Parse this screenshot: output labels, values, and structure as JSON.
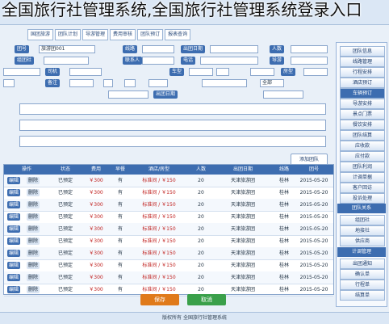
{
  "caption": "全国旅行社管理系统,全国旅行社管理系统登录入口",
  "tabs": [
    "国团旅游",
    "团队计划",
    "导游管理",
    "费用审核",
    "团队预订",
    "报表查询"
  ],
  "form_labels": [
    "团号",
    "线路",
    "出团日期",
    "人数",
    "组团社",
    "联系人",
    "电话",
    "导游",
    "司机",
    "车型",
    "房型",
    "备注"
  ],
  "form_values": [
    "旅游团001",
    "",
    "",
    "",
    "",
    "",
    "",
    "",
    "",
    "",
    "",
    ""
  ],
  "form_select": "全部",
  "add_button": "添加团队",
  "sidebar": {
    "items_top": [
      "团队信息",
      "线路管理",
      "行程安排",
      "酒店预订",
      "车辆预订",
      "导游安排",
      "景点门票",
      "餐饮安排",
      "团队结算",
      "应收款",
      "应付款",
      "团队利润",
      "计调单据",
      "客户回访",
      "投诉处理"
    ],
    "section1": "团队关系",
    "items_mid": [
      "组团社",
      "地接社",
      "供应商",
      "合作伙伴"
    ],
    "section2": "计调管理",
    "items_bottom": [
      "出团通知",
      "确认单",
      "行程单",
      "结算单",
      "费用单",
      "派车单",
      "报账单",
      "其他"
    ]
  },
  "table": {
    "headers": [
      "团号",
      "线路",
      "出团日期",
      "人数",
      "酒店/房型",
      "早餐",
      "费用",
      "状态",
      "操作"
    ],
    "rows": [
      [
        "2015-05-20",
        "桂林",
        "天津旅游团",
        "20",
        "标准间 / ￥150",
        "有",
        "￥300",
        "已预定"
      ],
      [
        "2015-05-20",
        "桂林",
        "天津旅游团",
        "20",
        "标准间 / ￥150",
        "有",
        "￥300",
        "已预定"
      ],
      [
        "2015-05-20",
        "桂林",
        "天津旅游团",
        "20",
        "标准间 / ￥150",
        "有",
        "￥300",
        "已预定"
      ],
      [
        "2015-05-20",
        "桂林",
        "天津旅游团",
        "20",
        "标准间 / ￥150",
        "有",
        "￥300",
        "已预定"
      ],
      [
        "2015-05-20",
        "桂林",
        "天津旅游团",
        "20",
        "标准间 / ￥150",
        "有",
        "￥300",
        "已预定"
      ],
      [
        "2015-05-20",
        "桂林",
        "天津旅游团",
        "20",
        "标准间 / ￥150",
        "有",
        "￥300",
        "已预定"
      ],
      [
        "2015-05-20",
        "桂林",
        "天津旅游团",
        "20",
        "标准间 / ￥150",
        "有",
        "￥300",
        "已预定"
      ],
      [
        "2015-05-20",
        "桂林",
        "天津旅游团",
        "20",
        "标准间 / ￥150",
        "有",
        "￥300",
        "已预定"
      ],
      [
        "2015-05-20",
        "桂林",
        "天津旅游团",
        "20",
        "标准间 / ￥150",
        "有",
        "￥300",
        "已预定"
      ],
      [
        "2015-05-20",
        "桂林",
        "天津旅游团",
        "20",
        "标准间 / ￥150",
        "有",
        "￥300",
        "已预定"
      ]
    ],
    "edit_label": "编辑",
    "delete_label": "删除"
  },
  "actions": {
    "save": "保存",
    "cancel": "取消"
  },
  "footer": "版权所有 全国旅行社管理系统",
  "colors": {
    "accent": "#3d6db0",
    "save": "#e07a1a",
    "cancel": "#3aa04a",
    "price": "#c0201e"
  }
}
